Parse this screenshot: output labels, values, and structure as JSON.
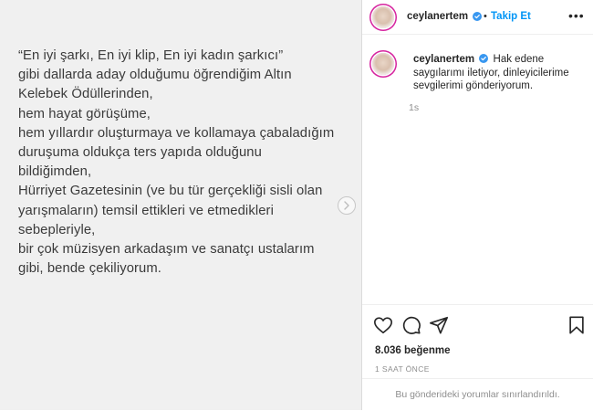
{
  "post": {
    "media_lines": [
      "“En iyi şarkı, En iyi klip, En iyi kadın şarkıcı”",
      "gibi dallarda aday olduğumu öğrendiğim Altın",
      "Kelebek Ödüllerinden,",
      "hem hayat görüşüme,",
      "hem yıllardır oluşturmaya ve kollamaya çabaladığım",
      "duruşuma oldukça ters yapıda olduğunu",
      "bildiğimden,",
      "Hürriyet Gazetesinin (ve bu tür gerçekliği sisli olan",
      "yarışmaların) temsil ettikleri ve etmedikleri",
      "sebepleriyle,",
      "bir çok müzisyen arkadaşım ve sanatçı ustalarım",
      "gibi, bende çekiliyorum."
    ]
  },
  "header": {
    "username": "ceylanertem",
    "separator": "•",
    "follow_label": "Takip Et",
    "more_label": "•••"
  },
  "caption": {
    "username": "ceylanertem",
    "text": "Hak edene saygılarımı iletiyor, dinleyicilerime sevgilerimi gönderiyorum.",
    "time_ago": "1s"
  },
  "stats": {
    "likes_text": "8.036 beğenme",
    "posted_ago": "1 SAAT ÖNCE"
  },
  "footer": {
    "comments_disabled": "Bu gönderideki yorumlar sınırlandırıldı."
  },
  "colors": {
    "accent": "#0095f6",
    "story_ring": "#d6249f",
    "media_bg": "#f0f0f0"
  },
  "icons": [
    "chevron-right-icon",
    "verified-icon",
    "heart-icon",
    "comment-icon",
    "share-icon",
    "bookmark-icon"
  ]
}
